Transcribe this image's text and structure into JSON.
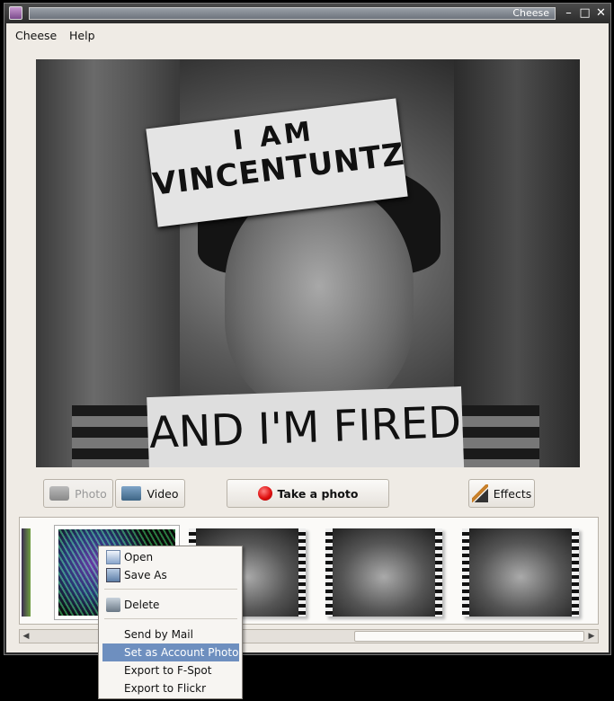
{
  "window": {
    "title": "Cheese"
  },
  "menubar": {
    "items": [
      "Cheese",
      "Help"
    ]
  },
  "viewport": {
    "sign_top_line1": "I AM",
    "sign_top_line2": "VINCENTUNTZ",
    "sign_bottom": "AND I'M FIRED"
  },
  "buttons": {
    "photo": "Photo",
    "video": "Video",
    "take_photo": "Take a photo",
    "effects": "Effects"
  },
  "context_menu": {
    "open": "Open",
    "save_as": "Save As",
    "delete": "Delete",
    "send_by_mail": "Send by Mail",
    "set_as_account_photo": "Set as Account Photo",
    "export_fspot": "Export to F-Spot",
    "export_flickr": "Export to Flickr"
  },
  "icons": {
    "app": "cheese-app-icon",
    "minimize": "minimize-icon",
    "maximize": "maximize-icon",
    "close": "close-icon"
  }
}
